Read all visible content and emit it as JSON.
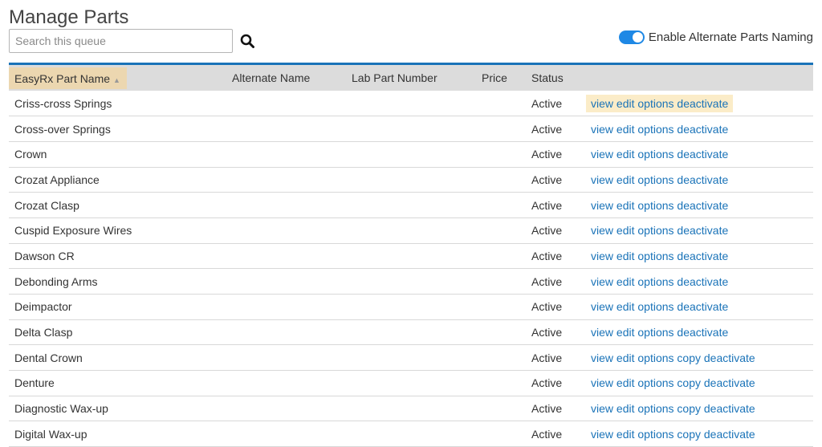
{
  "page": {
    "title": "Manage Parts"
  },
  "search": {
    "placeholder": "Search this queue",
    "icon": "search-icon"
  },
  "alt_naming": {
    "label": "Enable Alternate Parts Naming",
    "enabled": true,
    "color": "#1e88e5"
  },
  "table": {
    "headers": {
      "name": "EasyRx Part Name",
      "alternate": "Alternate Name",
      "lab_number": "Lab Part Number",
      "price": "Price",
      "status": "Status"
    },
    "sort": {
      "column": "name",
      "direction": "ascending"
    },
    "rows": [
      {
        "name": "Criss-cross Springs",
        "alternate": "",
        "lab_number": "",
        "price": "",
        "status": "Active",
        "actions": [
          "view",
          "edit",
          "options",
          "deactivate"
        ]
      },
      {
        "name": "Cross-over Springs",
        "alternate": "",
        "lab_number": "",
        "price": "",
        "status": "Active",
        "actions": [
          "view",
          "edit",
          "options",
          "deactivate"
        ]
      },
      {
        "name": "Crown",
        "alternate": "",
        "lab_number": "",
        "price": "",
        "status": "Active",
        "actions": [
          "view",
          "edit",
          "options",
          "deactivate"
        ]
      },
      {
        "name": "Crozat Appliance",
        "alternate": "",
        "lab_number": "",
        "price": "",
        "status": "Active",
        "actions": [
          "view",
          "edit",
          "options",
          "deactivate"
        ]
      },
      {
        "name": "Crozat Clasp",
        "alternate": "",
        "lab_number": "",
        "price": "",
        "status": "Active",
        "actions": [
          "view",
          "edit",
          "options",
          "deactivate"
        ]
      },
      {
        "name": "Cuspid Exposure Wires",
        "alternate": "",
        "lab_number": "",
        "price": "",
        "status": "Active",
        "actions": [
          "view",
          "edit",
          "options",
          "deactivate"
        ]
      },
      {
        "name": "Dawson CR",
        "alternate": "",
        "lab_number": "",
        "price": "",
        "status": "Active",
        "actions": [
          "view",
          "edit",
          "options",
          "deactivate"
        ]
      },
      {
        "name": "Debonding Arms",
        "alternate": "",
        "lab_number": "",
        "price": "",
        "status": "Active",
        "actions": [
          "view",
          "edit",
          "options",
          "deactivate"
        ]
      },
      {
        "name": "Deimpactor",
        "alternate": "",
        "lab_number": "",
        "price": "",
        "status": "Active",
        "actions": [
          "view",
          "edit",
          "options",
          "deactivate"
        ]
      },
      {
        "name": "Delta Clasp",
        "alternate": "",
        "lab_number": "",
        "price": "",
        "status": "Active",
        "actions": [
          "view",
          "edit",
          "options",
          "deactivate"
        ]
      },
      {
        "name": "Dental Crown",
        "alternate": "",
        "lab_number": "",
        "price": "",
        "status": "Active",
        "actions": [
          "view",
          "edit",
          "options",
          "copy",
          "deactivate"
        ]
      },
      {
        "name": "Denture",
        "alternate": "",
        "lab_number": "",
        "price": "",
        "status": "Active",
        "actions": [
          "view",
          "edit",
          "options",
          "copy",
          "deactivate"
        ]
      },
      {
        "name": "Diagnostic Wax-up",
        "alternate": "",
        "lab_number": "",
        "price": "",
        "status": "Active",
        "actions": [
          "view",
          "edit",
          "options",
          "copy",
          "deactivate"
        ]
      },
      {
        "name": "Digital Wax-up",
        "alternate": "",
        "lab_number": "",
        "price": "",
        "status": "Active",
        "actions": [
          "view",
          "edit",
          "options",
          "copy",
          "deactivate"
        ]
      }
    ]
  },
  "colors": {
    "accent": "#1a73b8",
    "header_bg": "#dcdcdc",
    "sort_highlight": "#ecd7b0",
    "row_highlight": "#fbecc8"
  }
}
